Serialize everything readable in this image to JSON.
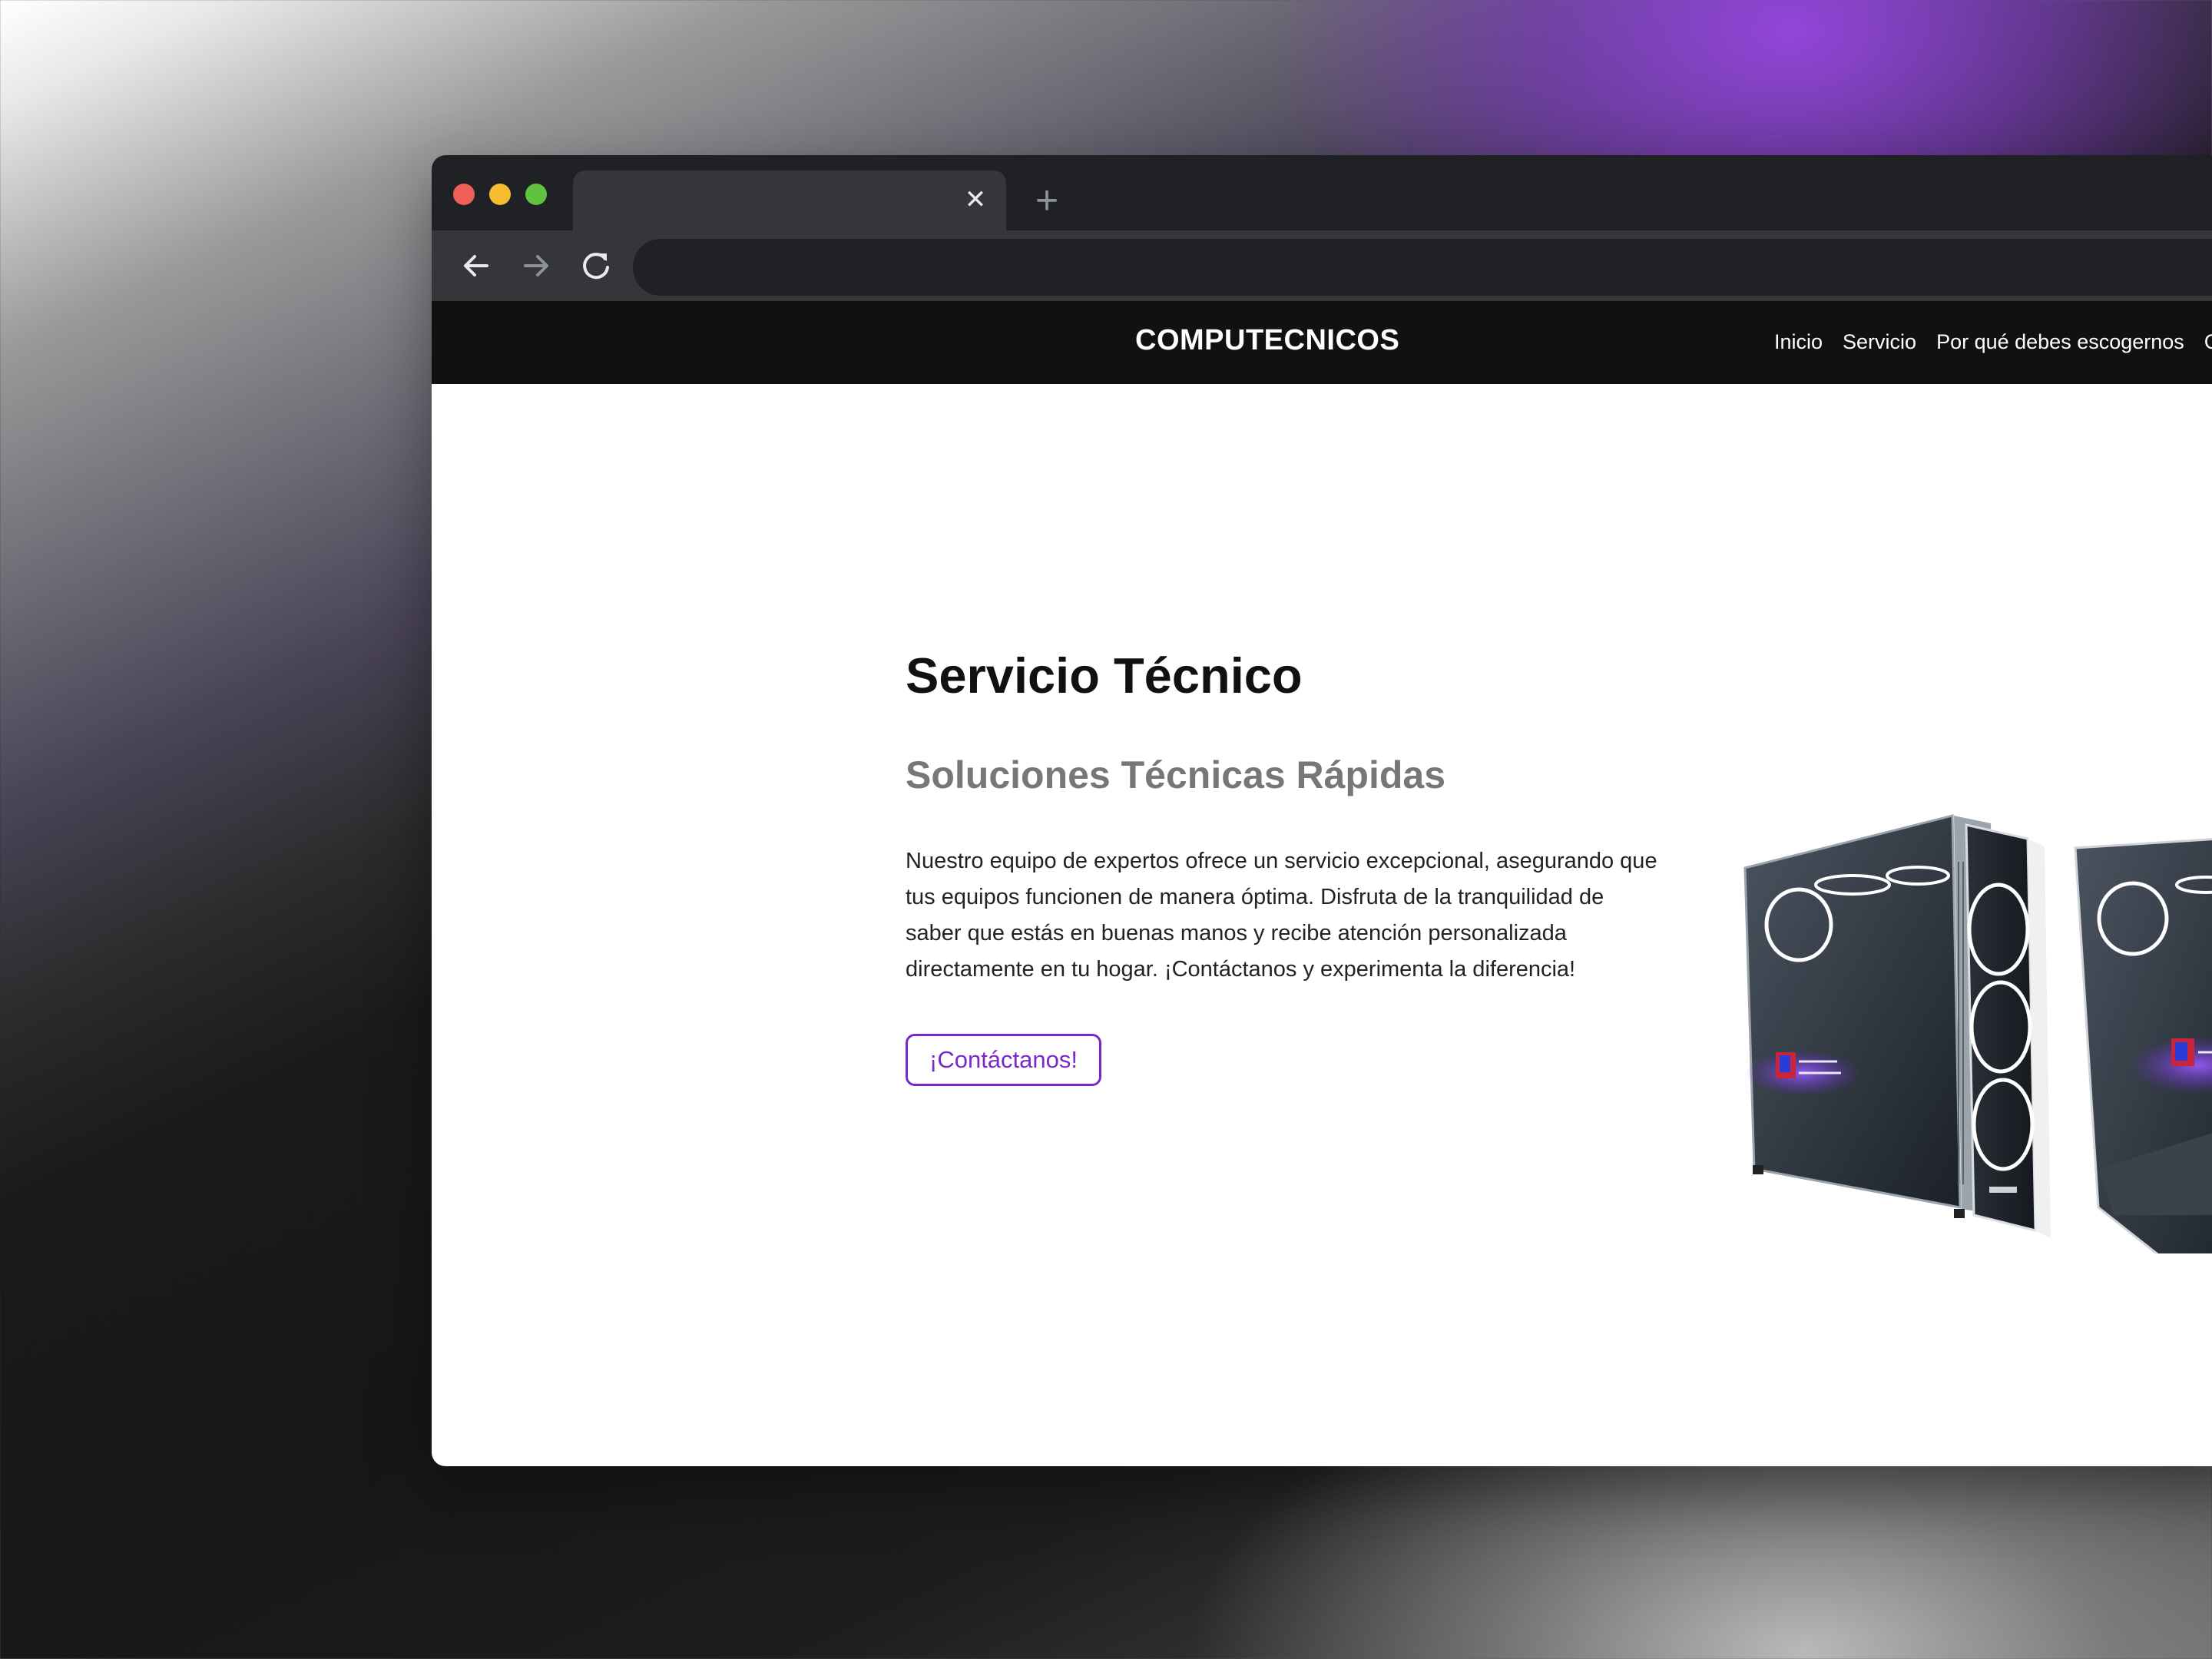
{
  "browser": {
    "tab": {
      "close_icon": "close-icon"
    },
    "new_tab_icon": "plus-icon",
    "toolbar": {
      "back_icon": "arrow-left-icon",
      "forward_icon": "arrow-right-icon",
      "reload_icon": "reload-icon"
    },
    "address_bar": {
      "value": ""
    }
  },
  "site": {
    "brand": "COMPUTECNICOS",
    "nav": [
      {
        "label": "Inicio"
      },
      {
        "label": "Servicio"
      },
      {
        "label": "Por qué debes escogernos"
      },
      {
        "label": "C"
      }
    ]
  },
  "hero": {
    "title": "Servicio Técnico",
    "subtitle": "Soluciones Técnicas Rápidas",
    "description": "Nuestro equipo de expertos ofrece un servicio excepcional, asegurando que tus equipos funcionen de manera óptima. Disfruta de la tranquilidad de saber que estás en buenas manos y recibe atención personalizada directamente en tu hogar. ¡Contáctanos y experimenta la diferencia!",
    "cta_label": "¡Contáctanos!",
    "image": "pc-cases-image"
  },
  "colors": {
    "accent": "#7a28c8",
    "navbar": "#111111",
    "browser_chrome": "#202124",
    "browser_toolbar": "#35363a"
  }
}
